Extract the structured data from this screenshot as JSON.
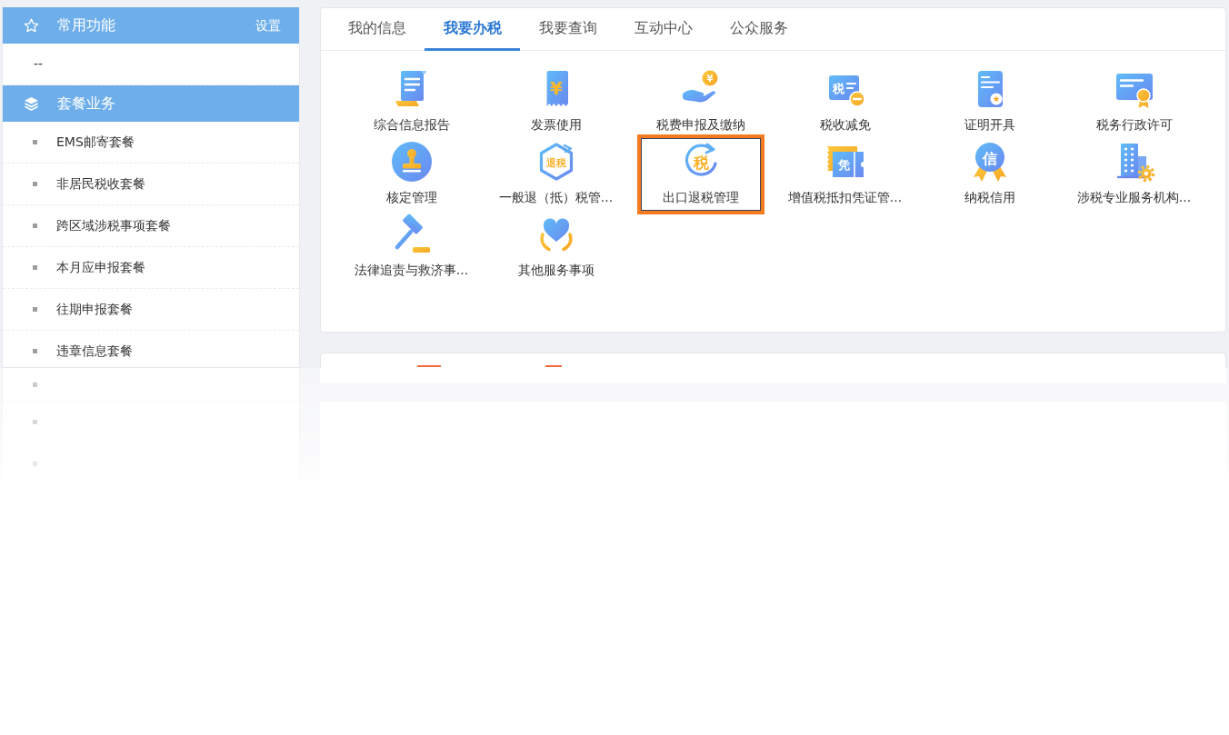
{
  "sidebar": [
    {
      "kind": "favorites",
      "title": "常用功能",
      "action": "设置",
      "empty_text": "--"
    },
    {
      "kind": "packages",
      "title": "套餐业务",
      "items": [
        "EMS邮寄套餐",
        "非居民税收套餐",
        "跨区域涉税事项套餐",
        "本月应申报套餐",
        "往期申报套餐",
        "违章信息套餐"
      ]
    }
  ],
  "tabs": [
    {
      "label": "我的信息",
      "selected": false
    },
    {
      "label": "我要办税",
      "selected": true
    },
    {
      "label": "我要查询",
      "selected": false
    },
    {
      "label": "互动中心",
      "selected": false
    },
    {
      "label": "公众服务",
      "selected": false
    }
  ],
  "services": [
    {
      "kind": "report",
      "label": "综合信息报告",
      "highlighted": false
    },
    {
      "kind": "invoice",
      "label": "发票使用",
      "icon_text": "¥",
      "highlighted": false
    },
    {
      "kind": "payment",
      "label": "税费申报及缴纳",
      "icon_text": "¥",
      "highlighted": false
    },
    {
      "kind": "relief",
      "label": "税收减免",
      "icon_text": "税",
      "highlighted": false
    },
    {
      "kind": "certificate",
      "label": "证明开具",
      "highlighted": false
    },
    {
      "kind": "permit",
      "label": "税务行政许可",
      "highlighted": false
    },
    {
      "kind": "stamp",
      "label": "核定管理",
      "highlighted": false
    },
    {
      "kind": "refund",
      "label": "一般退（抵）税管...",
      "icon_text": "退税",
      "highlighted": false
    },
    {
      "kind": "export",
      "label": "出口退税管理",
      "icon_text": "税",
      "highlighted": true
    },
    {
      "kind": "voucher",
      "label": "增值税抵扣凭证管...",
      "icon_text": "凭",
      "highlighted": false
    },
    {
      "kind": "credit",
      "label": "纳税信用",
      "icon_text": "信",
      "highlighted": false
    },
    {
      "kind": "agency",
      "label": "涉税专业服务机构...",
      "highlighted": false
    },
    {
      "kind": "gavel",
      "label": "法律追责与救济事...",
      "highlighted": false
    },
    {
      "kind": "care",
      "label": "其他服务事项",
      "highlighted": false
    }
  ]
}
